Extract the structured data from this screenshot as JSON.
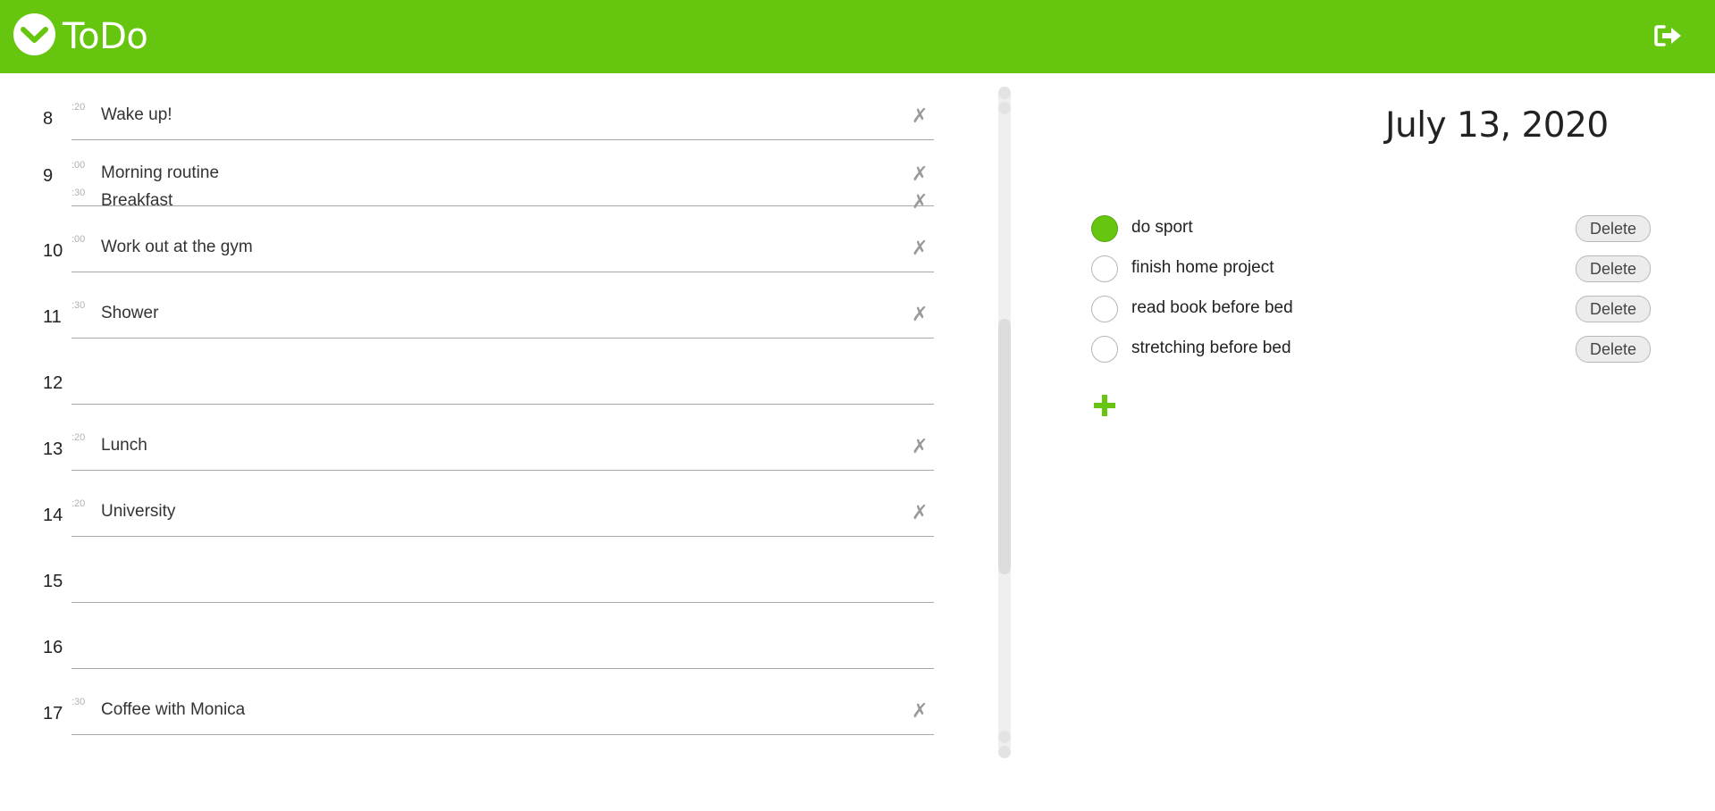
{
  "app": {
    "title": "ToDo",
    "accent": "#66c50f"
  },
  "header": {
    "logout_icon": "logout-icon"
  },
  "schedule": {
    "hours": [
      {
        "hour": "8",
        "entries": [
          {
            "minute": ":20",
            "text": "Wake up!"
          }
        ]
      },
      {
        "hour": "9",
        "entries": [
          {
            "minute": ":00",
            "text": "Morning routine"
          },
          {
            "minute": ":30",
            "text": "Breakfast"
          }
        ]
      },
      {
        "hour": "10",
        "entries": [
          {
            "minute": ":00",
            "text": "Work out at the gym"
          }
        ]
      },
      {
        "hour": "11",
        "entries": [
          {
            "minute": ":30",
            "text": "Shower"
          }
        ]
      },
      {
        "hour": "12",
        "entries": []
      },
      {
        "hour": "13",
        "entries": [
          {
            "minute": ":20",
            "text": "Lunch"
          }
        ]
      },
      {
        "hour": "14",
        "entries": [
          {
            "minute": ":20",
            "text": "University"
          }
        ]
      },
      {
        "hour": "15",
        "entries": []
      },
      {
        "hour": "16",
        "entries": []
      },
      {
        "hour": "17",
        "entries": [
          {
            "minute": ":30",
            "text": "Coffee with Monica"
          }
        ]
      }
    ],
    "delete_glyph": "✗"
  },
  "todo": {
    "date": "July 13, 2020",
    "delete_label": "Delete",
    "items": [
      {
        "text": "do sport",
        "done": true
      },
      {
        "text": "finish home project",
        "done": false
      },
      {
        "text": "read book before bed",
        "done": false
      },
      {
        "text": "stretching before bed",
        "done": false
      }
    ],
    "add_icon": "plus-icon"
  }
}
